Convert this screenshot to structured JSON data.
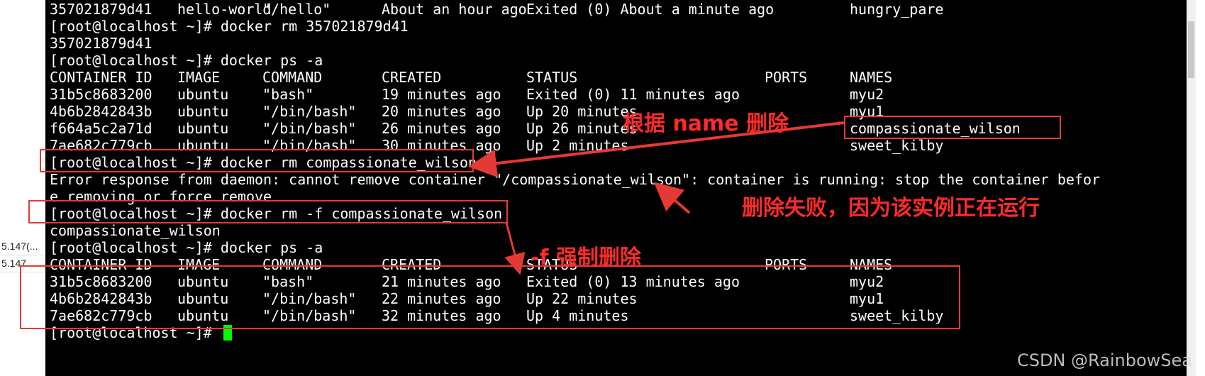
{
  "left_panel": {
    "rows": [
      "5.147(...",
      "5.147"
    ]
  },
  "table_cols": [
    "CONTAINER ID",
    "IMAGE",
    "COMMAND",
    "CREATED",
    "STATUS",
    "PORTS",
    "NAMES"
  ],
  "lines": [
    {
      "kind": "row",
      "cells": [
        "357021879d41",
        "hello-world",
        "\"/hello\"",
        "About an hour ago",
        "Exited (0) About a minute ago",
        "",
        "hungry_pare"
      ]
    },
    {
      "kind": "text",
      "text": "[root@localhost ~]# docker rm 357021879d41"
    },
    {
      "kind": "text",
      "text": "357021879d41"
    },
    {
      "kind": "text",
      "text": "[root@localhost ~]# docker ps -a"
    },
    {
      "kind": "header"
    },
    {
      "kind": "row",
      "cells": [
        "31b5c8683200",
        "ubuntu",
        "\"bash\"",
        "19 minutes ago",
        "Exited (0) 11 minutes ago",
        "",
        "myu2"
      ]
    },
    {
      "kind": "row",
      "cells": [
        "4b6b2842843b",
        "ubuntu",
        "\"/bin/bash\"",
        "20 minutes ago",
        "Up 20 minutes",
        "",
        "myu1"
      ]
    },
    {
      "kind": "row",
      "cells": [
        "f664a5c2a71d",
        "ubuntu",
        "\"/bin/bash\"",
        "26 minutes ago",
        "Up 26 minutes",
        "",
        "compassionate_wilson"
      ]
    },
    {
      "kind": "row",
      "cells": [
        "7ae682c779cb",
        "ubuntu",
        "\"/bin/bash\"",
        "30 minutes ago",
        "Up 2 minutes",
        "",
        "sweet_kilby"
      ]
    },
    {
      "kind": "text",
      "text": "[root@localhost ~]# docker rm compassionate_wilson"
    },
    {
      "kind": "text",
      "text": "Error response from daemon: cannot remove container \"/compassionate_wilson\": container is running: stop the container befor"
    },
    {
      "kind": "text",
      "text": "e removing or force remove"
    },
    {
      "kind": "text",
      "text": "[root@localhost ~]# docker rm -f compassionate_wilson"
    },
    {
      "kind": "text",
      "text": "compassionate_wilson"
    },
    {
      "kind": "text",
      "text": "[root@localhost ~]# docker ps -a"
    },
    {
      "kind": "header"
    },
    {
      "kind": "row",
      "cells": [
        "31b5c8683200",
        "ubuntu",
        "\"bash\"",
        "21 minutes ago",
        "Exited (0) 13 minutes ago",
        "",
        "myu2"
      ]
    },
    {
      "kind": "row",
      "cells": [
        "4b6b2842843b",
        "ubuntu",
        "\"/bin/bash\"",
        "22 minutes ago",
        "Up 22 minutes",
        "",
        "myu1"
      ]
    },
    {
      "kind": "row",
      "cells": [
        "7ae682c779cb",
        "ubuntu",
        "\"/bin/bash\"",
        "32 minutes ago",
        "Up 4 minutes",
        "",
        "sweet_kilby"
      ]
    },
    {
      "kind": "prompt",
      "text": "[root@localhost ~]# "
    }
  ],
  "annotations": {
    "by_name": "根据 name 删除",
    "fail_reason": "删除失败，因为该实例正在运行",
    "force": "-f 强制删除",
    "color": "#e53935"
  },
  "watermark": "CSDN @RainbowSea"
}
